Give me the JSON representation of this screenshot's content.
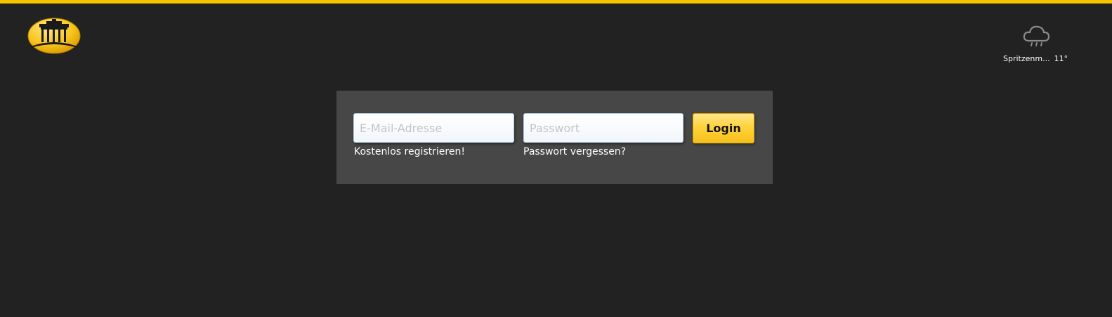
{
  "header": {
    "logo_icon": "brandenburg-gate-logo-icon",
    "accent_color": "#f5c400",
    "weather": {
      "icon": "rain-cloud-icon",
      "location": "Spritzenm...",
      "temperature": "11°"
    }
  },
  "login": {
    "email_placeholder": "E-Mail-Adresse",
    "email_value": "",
    "password_placeholder": "Passwort",
    "password_value": "",
    "login_label": "Login",
    "register_link": "Kostenlos registrieren!",
    "forgot_link": "Passwort vergessen?"
  }
}
